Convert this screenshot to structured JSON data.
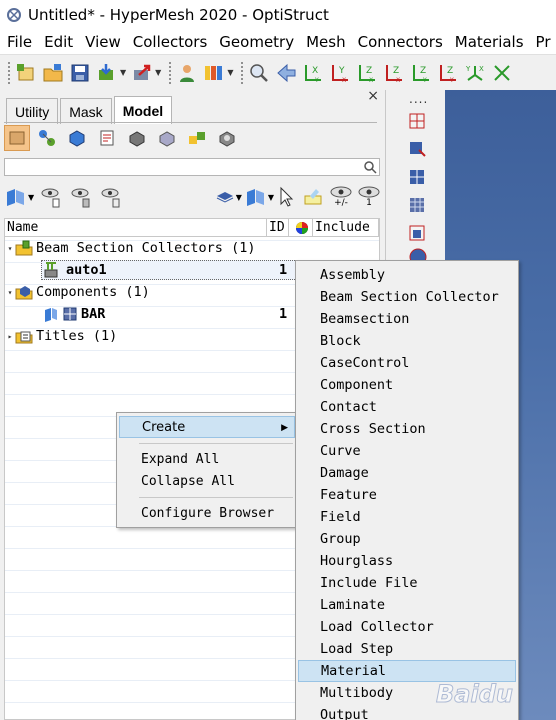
{
  "window": {
    "title": "Untitled* - HyperMesh 2020 - OptiStruct"
  },
  "menubar": {
    "items": [
      "File",
      "Edit",
      "View",
      "Collectors",
      "Geometry",
      "Mesh",
      "Connectors",
      "Materials",
      "Pr"
    ]
  },
  "toolbar": {
    "axis_labels": [
      "X",
      "Y",
      "Z"
    ]
  },
  "panel": {
    "close_label": "×",
    "tabs": [
      {
        "label": "Utility",
        "active": false
      },
      {
        "label": "Mask",
        "active": false
      },
      {
        "label": "Model",
        "active": true
      }
    ],
    "columns": {
      "name": "Name",
      "id": "ID",
      "include": "Include"
    },
    "tree": [
      {
        "label": "Beam Section Collectors (1)",
        "level": 0,
        "icon": "beam-section-collector-icon"
      },
      {
        "label": "auto1",
        "level": 1,
        "id": "1",
        "icon": "beam-section-icon",
        "selected": true
      },
      {
        "label": "Components (1)",
        "level": 0,
        "icon": "components-icon"
      },
      {
        "label": "BAR",
        "level": 1,
        "id": "1",
        "icon": "component-icon"
      },
      {
        "label": "Titles (1)",
        "level": 0,
        "icon": "titles-icon"
      }
    ],
    "vis_labels": {
      "plus_minus": "+/-",
      "one": "1"
    }
  },
  "strip": {
    "dots": "...."
  },
  "context_menu": {
    "items": [
      "Create",
      "Expand All",
      "Collapse All",
      "Configure Browser"
    ],
    "highlighted": "Create"
  },
  "create_submenu": {
    "items": [
      "Assembly",
      "Beam Section Collector",
      "Beamsection",
      "Block",
      "CaseControl",
      "Component",
      "Contact",
      "Cross Section",
      "Curve",
      "Damage",
      "Feature",
      "Field",
      "Group",
      "Hourglass",
      "Include File",
      "Laminate",
      "Load Collector",
      "Load Step",
      "Material",
      "Multibody",
      "Output"
    ],
    "highlighted": "Material"
  },
  "watermark": {
    "text": "Baidu"
  }
}
